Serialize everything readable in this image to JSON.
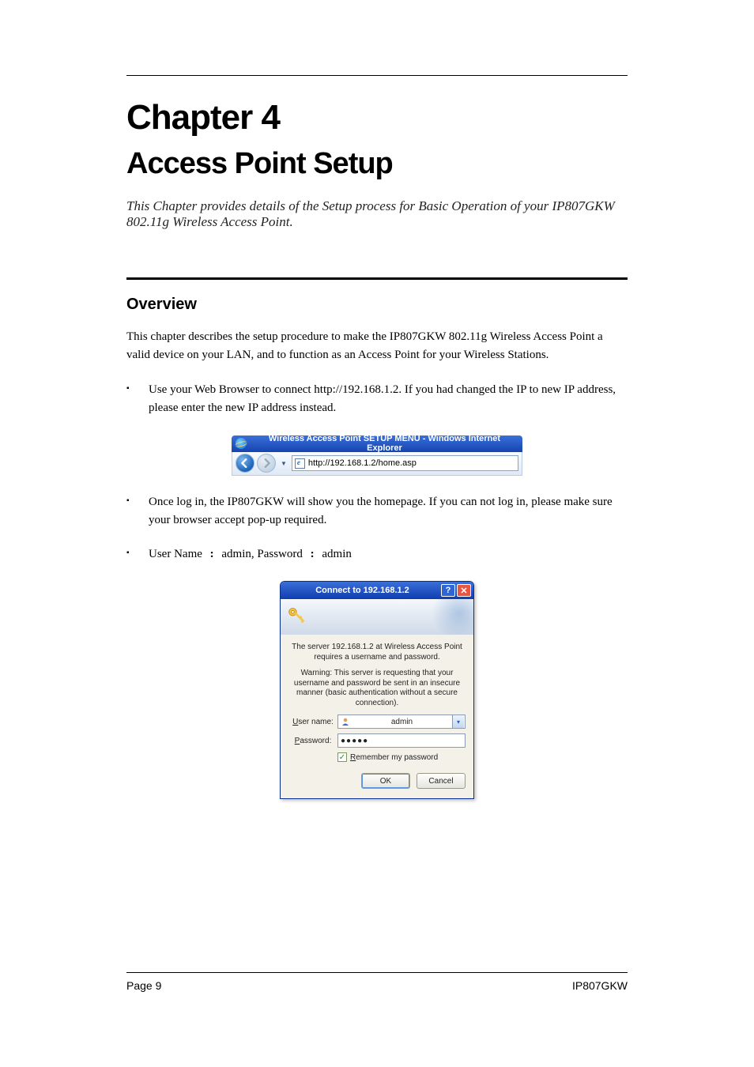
{
  "chapter": {
    "num": "Chapter 4",
    "title": "Access Point Setup",
    "subtitle": "This Chapter provides details of the Setup process for Basic Operation of your IP807GKW 802.11g Wireless Access Point."
  },
  "section_h2": "Overview",
  "overview_text": "This chapter describes the setup procedure to make the IP807GKW 802.11g Wireless Access Point a valid device on your LAN, and to function as an Access Point for your Wireless Stations.",
  "steps": {
    "step1": "Use your Web Browser to connect http://192.168.1.2. If you had changed the IP to new IP address, please enter the new IP address instead.",
    "step2": "Once log in, the IP807GKW will show you the homepage. If you can not log in, please make sure your browser accept pop-up required.",
    "step3_prefix": "User Name",
    "step3_mid": "admin, Password",
    "step3_val": "admin"
  },
  "ie_bar": {
    "title": "Wireless Access Point SETUP MENU - Windows Internet Explorer",
    "url": "http://192.168.1.2/home.asp"
  },
  "auth": {
    "title": "Connect to 192.168.1.2",
    "msg1": "The server 192.168.1.2 at Wireless Access Point requires a username and password.",
    "msg2": "Warning: This server is requesting that your username and password be sent in an insecure manner (basic authentication without a secure connection).",
    "user_label": "User name:",
    "user_value": "admin",
    "pass_label": "Password:",
    "pass_value": "●●●●●",
    "remember": "Remember my password",
    "ok": "OK",
    "cancel": "Cancel"
  },
  "footer": {
    "left": "Page 9",
    "right": "IP807GKW"
  }
}
